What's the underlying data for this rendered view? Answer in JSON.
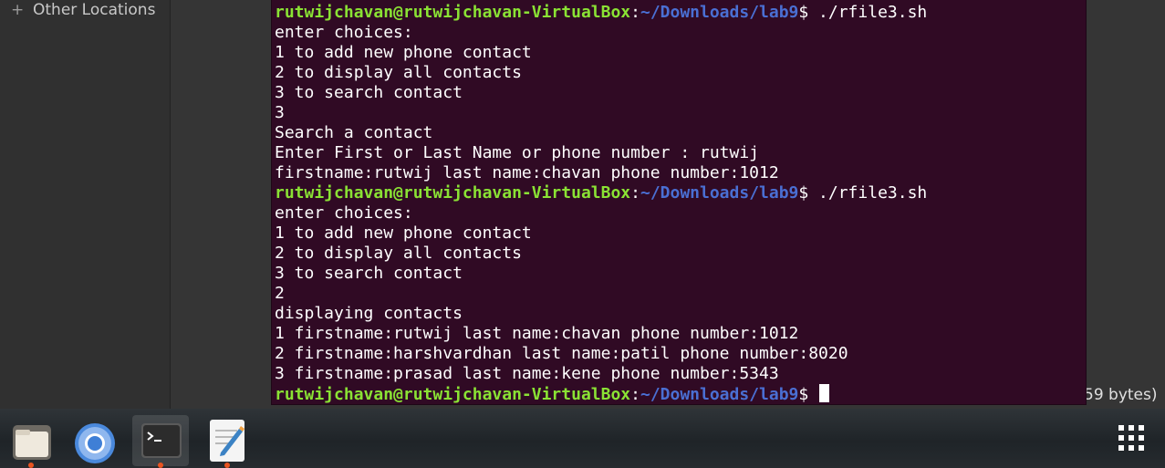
{
  "files": {
    "sidebar_item": "Other Locations",
    "status_fragment": "59 bytes)"
  },
  "terminal": {
    "lines": [
      {
        "user": "rutwijchavan@rutwijchavan-VirtualBox",
        "path": "~/Downloads/lab9",
        "cmd": "$ ./rfile3.sh"
      },
      {
        "text": "enter choices:"
      },
      {
        "text": "1 to add new phone contact"
      },
      {
        "text": "2 to display all contacts"
      },
      {
        "text": "3 to search contact"
      },
      {
        "text": "3"
      },
      {
        "text": "Search a contact"
      },
      {
        "text": "Enter First or Last Name or phone number : rutwij"
      },
      {
        "text": "firstname:rutwij last name:chavan phone number:1012"
      },
      {
        "user": "rutwijchavan@rutwijchavan-VirtualBox",
        "path": "~/Downloads/lab9",
        "cmd": "$ ./rfile3.sh"
      },
      {
        "text": "enter choices:"
      },
      {
        "text": "1 to add new phone contact"
      },
      {
        "text": "2 to display all contacts"
      },
      {
        "text": "3 to search contact"
      },
      {
        "text": "2"
      },
      {
        "text": "displaying contacts"
      },
      {
        "text": "1 firstname:rutwij last name:chavan phone number:1012"
      },
      {
        "text": "2 firstname:harshvardhan last name:patil phone number:8020"
      },
      {
        "text": "3 firstname:prasad last name:kene phone number:5343"
      },
      {
        "user": "rutwijchavan@rutwijchavan-VirtualBox",
        "path": "~/Downloads/lab9",
        "cmd": "$ ",
        "cursor": true
      }
    ]
  },
  "dock": {
    "apps": [
      {
        "name": "files",
        "icon": "folder-icon",
        "running": true
      },
      {
        "name": "chromium",
        "icon": "chromium-icon",
        "running": false
      },
      {
        "name": "terminal",
        "icon": "terminal-icon",
        "running": true,
        "active": true
      },
      {
        "name": "text-editor",
        "icon": "text-editor-icon",
        "running": true
      }
    ],
    "show_apps_icon": "app-grid-icon"
  },
  "colors": {
    "terminal_bg": "#300a24",
    "prompt_user": "#8ae234",
    "prompt_path": "#4a6fd3",
    "running_dot": "#e95420"
  }
}
